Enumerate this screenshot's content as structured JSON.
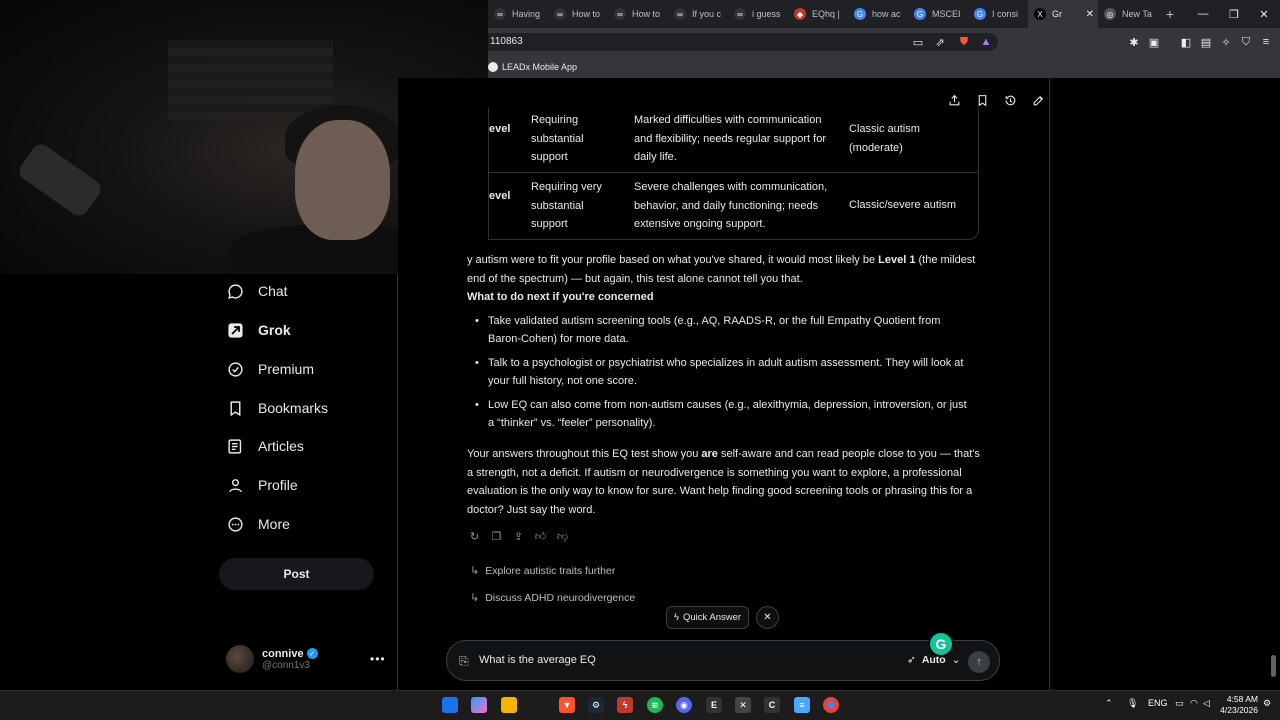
{
  "browser": {
    "tabs": [
      {
        "title": "Having",
        "active": false
      },
      {
        "title": "How to",
        "active": false
      },
      {
        "title": "How to",
        "active": false
      },
      {
        "title": "If you c",
        "active": false
      },
      {
        "title": "i guess",
        "active": false
      },
      {
        "title": "EQhq |",
        "active": false
      },
      {
        "title": "how ac",
        "active": false
      },
      {
        "title": "MSCEI",
        "active": false
      },
      {
        "title": "I consi",
        "active": false
      },
      {
        "title": "Gr",
        "active": true
      },
      {
        "title": "New Ta",
        "active": false
      }
    ],
    "new_tab": "+",
    "url": "110863",
    "bookmark": "LEADx Mobile App"
  },
  "sidebar": {
    "items": [
      {
        "label": "Chat",
        "icon": "chat-bubble-icon"
      },
      {
        "label": "Grok",
        "icon": "grok-icon"
      },
      {
        "label": "Premium",
        "icon": "verified-badge-icon"
      },
      {
        "label": "Bookmarks",
        "icon": "bookmark-icon"
      },
      {
        "label": "Articles",
        "icon": "article-icon"
      },
      {
        "label": "Profile",
        "icon": "person-icon"
      },
      {
        "label": "More",
        "icon": "more-circle-icon"
      }
    ],
    "post_label": "Post",
    "account": {
      "name": "connive",
      "handle": "@conn1v3"
    }
  },
  "chat": {
    "table": {
      "rows": [
        {
          "level": "evel",
          "support": "Requiring substantial support",
          "description": "Marked difficulties with communication and flexibility; needs regular support for daily life.",
          "traditional": "Classic autism (moderate)"
        },
        {
          "level": "evel",
          "support": "Requiring very substantial support",
          "description": "Severe challenges with communication, behavior, and daily functioning; needs extensive ongoing support.",
          "traditional": "Classic/severe autism"
        }
      ]
    },
    "level_para_before": "y autism were to fit your profile based on what you've shared, it would most likely be ",
    "level_para_bold": "Level 1",
    "level_para_after": " (the mildest end of the spectrum) — but again, this test alone cannot tell you that.",
    "next_heading": "What to do next if you're concerned",
    "bullets": [
      "Take validated autism screening tools (e.g., AQ, RAADS-R, or the full Empathy Quotient from Baron-Cohen) for more data.",
      "Talk to a psychologist or psychiatrist who specializes in adult autism assessment. They will look at your full history, not one score.",
      "Low EQ can also come from non-autism causes (e.g., alexithymia, depression, introversion, or just a “thinker” vs. “feeler” personality)."
    ],
    "closing_before": "Your answers throughout this EQ test show you ",
    "closing_bold": "are",
    "closing_after": " self-aware and can read people close to you — that's a strength, not a deficit. If autism or neurodivergence is something you want to explore, a professional evaluation is the only way to know for sure. Want help finding good screening tools or phrasing this for a doctor? Just say the word.",
    "suggestions": [
      "Explore autistic traits further",
      "Discuss ADHD neurodivergence"
    ],
    "quick_answer": "Quick Answer",
    "composer_text": "What is the average EQ",
    "mode": "Auto"
  },
  "taskbar": {
    "lang": "ENG",
    "time": "4:58 AM",
    "date": "4/23/2026"
  },
  "colors": {
    "background": "#000000",
    "text": "#e7e9ea",
    "muted": "#71767b",
    "border": "#2f3336",
    "grammarly": "#15c39a",
    "verified": "#1d9bf0"
  }
}
